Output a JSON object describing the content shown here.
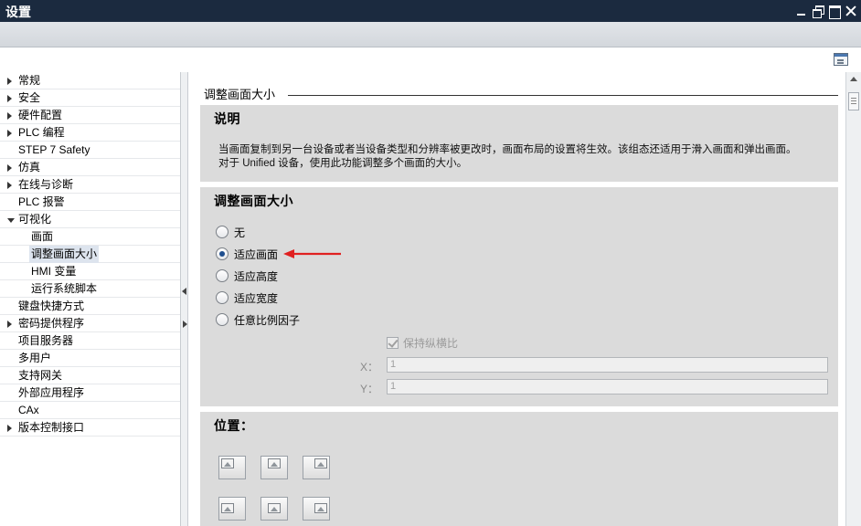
{
  "window": {
    "title": "设置"
  },
  "tree": {
    "items": [
      {
        "label": "常规",
        "level": 0,
        "expander": "collapsed"
      },
      {
        "label": "安全",
        "level": 0,
        "expander": "collapsed"
      },
      {
        "label": "硬件配置",
        "level": 0,
        "expander": "collapsed"
      },
      {
        "label": "PLC 编程",
        "level": 0,
        "expander": "collapsed"
      },
      {
        "label": "STEP 7 Safety",
        "level": 0,
        "expander": "none"
      },
      {
        "label": "仿真",
        "level": 0,
        "expander": "collapsed"
      },
      {
        "label": "在线与诊断",
        "level": 0,
        "expander": "collapsed"
      },
      {
        "label": "PLC 报警",
        "level": 0,
        "expander": "none"
      },
      {
        "label": "可视化",
        "level": 0,
        "expander": "expanded"
      },
      {
        "label": "画面",
        "level": 1,
        "expander": "none"
      },
      {
        "label": "调整画面大小",
        "level": 1,
        "expander": "none",
        "selected": true
      },
      {
        "label": "HMI 变量",
        "level": 1,
        "expander": "none"
      },
      {
        "label": "运行系统脚本",
        "level": 1,
        "expander": "none"
      },
      {
        "label": "键盘快捷方式",
        "level": 0,
        "expander": "none"
      },
      {
        "label": "密码提供程序",
        "level": 0,
        "expander": "collapsed"
      },
      {
        "label": "项目服务器",
        "level": 0,
        "expander": "none"
      },
      {
        "label": "多用户",
        "level": 0,
        "expander": "none"
      },
      {
        "label": "支持网关",
        "level": 0,
        "expander": "none"
      },
      {
        "label": "外部应用程序",
        "level": 0,
        "expander": "none"
      },
      {
        "label": "CAx",
        "level": 0,
        "expander": "none"
      },
      {
        "label": "版本控制接口",
        "level": 0,
        "expander": "collapsed"
      }
    ]
  },
  "main": {
    "section_title": "调整画面大小",
    "description": {
      "title": "说明",
      "line1": "当画面复制到另一台设备或者当设备类型和分辨率被更改时，画面布局的设置将生效。该组态还适用于滑入画面和弹出画面。",
      "line2": "对于 Unified 设备，使用此功能调整多个画面的大小。"
    },
    "resize": {
      "title": "调整画面大小",
      "options": [
        {
          "label": "无",
          "checked": false
        },
        {
          "label": "适应画面",
          "checked": true
        },
        {
          "label": "适应高度",
          "checked": false
        },
        {
          "label": "适应宽度",
          "checked": false
        },
        {
          "label": "任意比例因子",
          "checked": false
        }
      ],
      "keep_aspect": {
        "label": "保持纵横比",
        "checked": true,
        "enabled": false
      },
      "x": {
        "label": "X：",
        "value": "1"
      },
      "y": {
        "label": "Y：",
        "value": "1"
      }
    },
    "position": {
      "title": "位置："
    }
  },
  "colors": {
    "titlebar": "#1b2a3f",
    "panel": "#dbdbdb",
    "annotation_arrow": "#e02020"
  }
}
